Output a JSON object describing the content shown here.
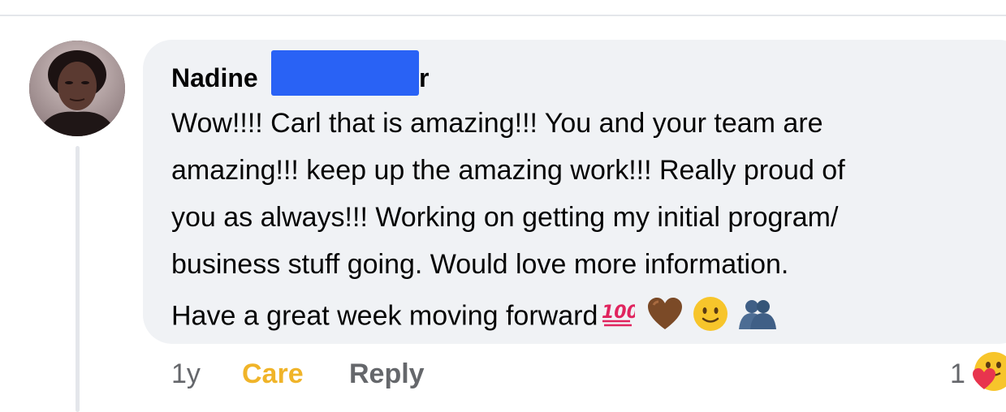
{
  "comment": {
    "author": {
      "first_name": "Nadine",
      "name_tail": "r",
      "avatar_icon": "profile-photo"
    },
    "lines": [
      "Wow!!!! Carl that is amazing!!! You and your team are",
      "amazing!!! keep up the amazing work!!! Really proud of",
      "you as always!!! Working on getting my initial program/",
      "business stuff going. Would love more information.",
      "Have a great week moving forward"
    ],
    "trailing_emojis": [
      "hundred-points-icon",
      "brown-heart-icon",
      "smiling-face-icon",
      "people-hugging-icon"
    ],
    "timestamp": "1y",
    "reaction_label": "Care",
    "reply_label": "Reply",
    "reaction_count": "1",
    "reaction_icon": "care-emoji-icon"
  },
  "colors": {
    "bubble": "#f0f2f5",
    "redaction": "#2962f5",
    "care": "#f0b429",
    "muted": "#65676b"
  }
}
